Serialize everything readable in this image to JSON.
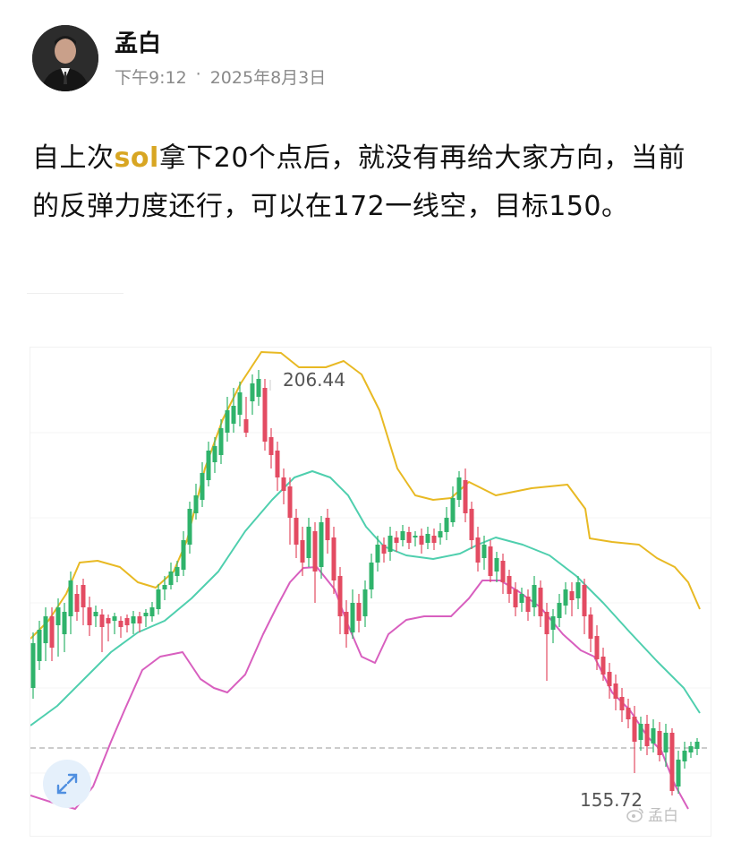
{
  "post": {
    "author": "孟白",
    "time": "下午9:12",
    "dot": "·",
    "date": "2025年8月3日",
    "text_before": "自上次",
    "highlight": "sol",
    "text_after": "拿下20个点后，就没有再给大家方向，当前的反弹力度还行，可以在172一线空，目标150。"
  },
  "chart": {
    "high_label": "206.44",
    "low_label": "155.72",
    "watermark": "孟白",
    "colors": {
      "up": "#2fb36b",
      "down": "#e34b62",
      "upper_band": "#e8b923",
      "middle_band": "#4fcfae",
      "lower_band": "#d85fbf"
    }
  },
  "icons": {
    "zoom": "expand-arrows-icon",
    "watermark": "weibo-logo-icon"
  }
}
